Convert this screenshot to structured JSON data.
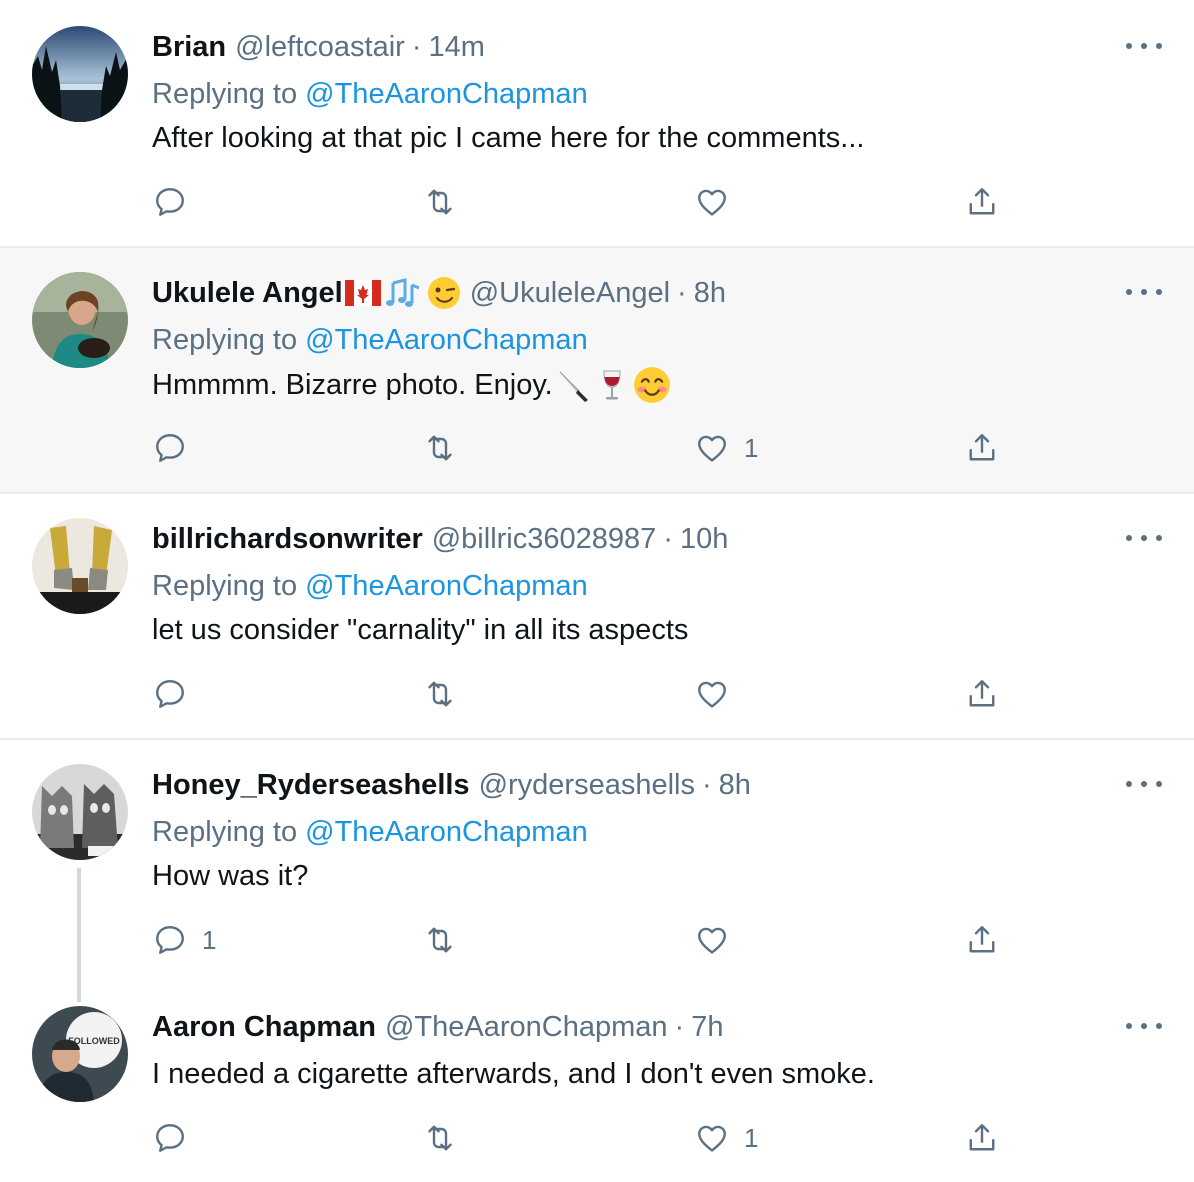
{
  "tweets": [
    {
      "name": "Brian",
      "handle": "@leftcoastair",
      "dot": "·",
      "time": "14m",
      "replying_prefix": "Replying to",
      "replying_to": "@TheAaronChapman",
      "text": "After looking at that pic I came here for the comments...",
      "reply_count": "",
      "retweet_count": "",
      "like_count": ""
    },
    {
      "name": "Ukulele Angel",
      "name_emojis": [
        "canada-flag-emoji",
        "musical-notes-emoji",
        "winking-face-emoji"
      ],
      "handle": "@UkuleleAngel",
      "dot": "·",
      "time": "8h",
      "replying_prefix": "Replying to",
      "replying_to": "@TheAaronChapman",
      "text": "Hmmmm. Bizarre photo. Enjoy.",
      "text_emojis": [
        "kitchen-knife-emoji",
        "wine-glass-emoji",
        "smiling-face-emoji"
      ],
      "reply_count": "",
      "retweet_count": "",
      "like_count": "1"
    },
    {
      "name": "billrichardsonwriter",
      "handle": "@billric36028987",
      "dot": "·",
      "time": "10h",
      "replying_prefix": "Replying to",
      "replying_to": "@TheAaronChapman",
      "text": "let us consider \"carnality\" in all its aspects",
      "reply_count": "",
      "retweet_count": "",
      "like_count": ""
    },
    {
      "name": "Honey_Ryderseashells",
      "handle": "@ryderseashells",
      "dot": "·",
      "time": "8h",
      "replying_prefix": "Replying to",
      "replying_to": "@TheAaronChapman",
      "text": "How was it?",
      "reply_count": "1",
      "retweet_count": "",
      "like_count": ""
    },
    {
      "name": "Aaron Chapman",
      "handle": "@TheAaronChapman",
      "dot": "·",
      "time": "7h",
      "text": "I needed a cigarette afterwards, and I don't even smoke.",
      "avatar_badge": "FOLLOWED",
      "reply_count": "",
      "retweet_count": "",
      "like_count": "1"
    }
  ],
  "icons": {
    "reply": "reply-icon",
    "retweet": "retweet-icon",
    "like": "like-icon",
    "share": "share-icon",
    "more": "more-icon"
  },
  "colors": {
    "text": "#0f1419",
    "secondary": "#5b7083",
    "link": "#1b95e0",
    "divider": "#e6ecf0",
    "shaded_row": "#f7f7f7"
  }
}
